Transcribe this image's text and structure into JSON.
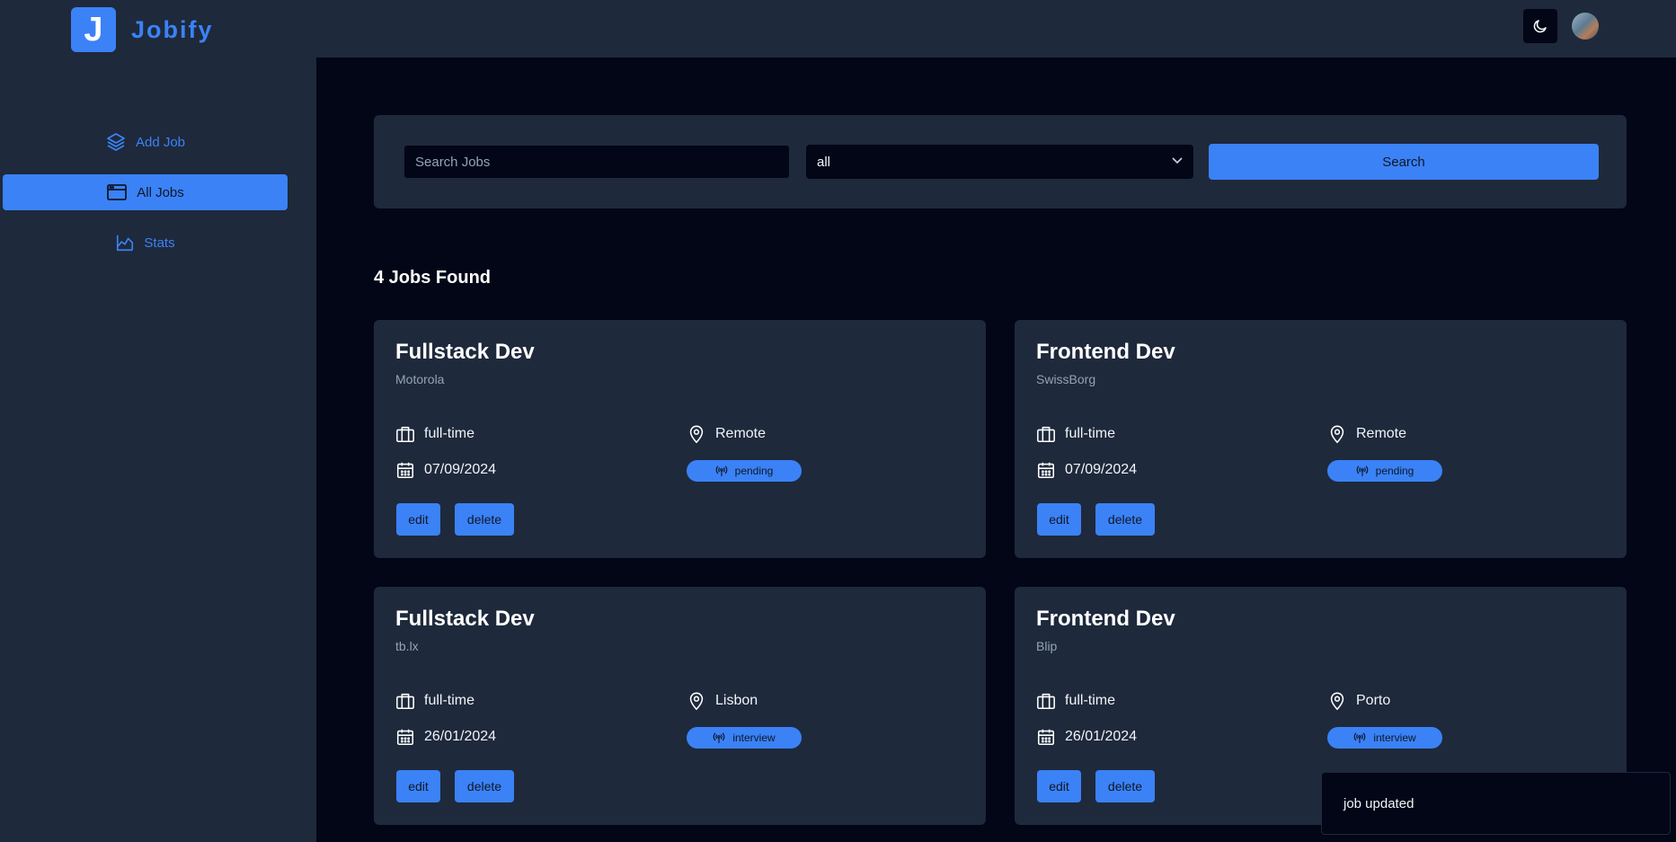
{
  "brand": {
    "logo_letter": "J",
    "name": "Jobify"
  },
  "nav": [
    {
      "label": "Add Job",
      "icon": "layers-icon",
      "active": false
    },
    {
      "label": "All Jobs",
      "icon": "browser-window-icon",
      "active": true
    },
    {
      "label": "Stats",
      "icon": "chart-icon",
      "active": false
    }
  ],
  "topbar": {
    "theme_icon": "moon-icon",
    "avatar": "avatar"
  },
  "search": {
    "placeholder": "Search Jobs",
    "status_value": "all",
    "button_label": "Search"
  },
  "jobs_count_label": "4 Jobs Found",
  "jobs": [
    {
      "position": "Fullstack Dev",
      "company": "Motorola",
      "type": "full-time",
      "location": "Remote",
      "date": "07/09/2024",
      "status": "pending"
    },
    {
      "position": "Frontend Dev",
      "company": "SwissBorg",
      "type": "full-time",
      "location": "Remote",
      "date": "07/09/2024",
      "status": "pending"
    },
    {
      "position": "Fullstack Dev",
      "company": "tb.lx",
      "type": "full-time",
      "location": "Lisbon",
      "date": "26/01/2024",
      "status": "interview"
    },
    {
      "position": "Frontend Dev",
      "company": "Blip",
      "type": "full-time",
      "location": "Porto",
      "date": "26/01/2024",
      "status": "interview"
    }
  ],
  "card_actions": {
    "edit_label": "edit",
    "delete_label": "delete"
  },
  "toast": {
    "message": "job updated"
  },
  "colors": {
    "accent": "#3b82f6",
    "panel": "#1e293b",
    "background": "#020617",
    "muted_text": "#94a3b8"
  }
}
